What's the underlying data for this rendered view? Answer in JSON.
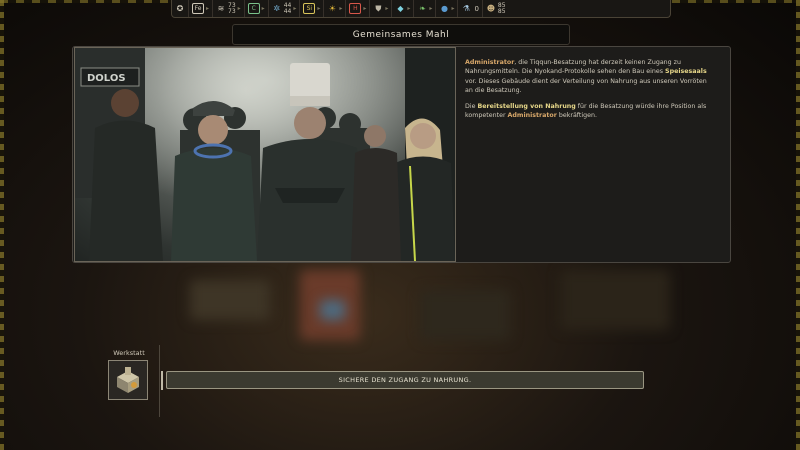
{
  "resource_bar": {
    "iron": {
      "icon": "fe-icon",
      "symbol": "Fe"
    },
    "materials": {
      "icon": "stack-icon",
      "top": "73",
      "bottom": "73"
    },
    "components": {
      "icon": "c-icon",
      "symbol": "C"
    },
    "machine_parts": {
      "icon": "gear-icon",
      "top": "44",
      "bottom": "44"
    },
    "silicon": {
      "icon": "si-icon",
      "symbol": "Si"
    },
    "energy": {
      "icon": "sun-icon",
      "symbol": "☀"
    },
    "health": {
      "icon": "h-icon",
      "symbol": "H"
    },
    "chemistry": {
      "icon": "flask-icon",
      "value": "0"
    },
    "population": {
      "icon": "population-icon",
      "top": "85",
      "bottom": "85"
    }
  },
  "event": {
    "title": "Gemeinsames Mahl",
    "paragraph1": {
      "hl1": "Administrator",
      "t1": ", die Tiqqun-Besatzung hat derzeit keinen Zugang zu Nahrungsmitteln. Die Nyokand-Protokolle sehen den Bau eines ",
      "hl2": "Speisesaals",
      "t2": " vor. Dieses Gebäude dient der Verteilung von Nahrung aus unseren Vorröten an die Besatzung."
    },
    "paragraph2": {
      "t1": " Die ",
      "hl1": "Bereitstellung von Nahrung",
      "t2": " für die Besatzung würde ihre Position als kompetenter ",
      "hl2": "Administrator",
      "t3": " bekräftigen."
    },
    "art_sign": "DOLOS"
  },
  "workshop": {
    "label": "Werkstatt",
    "icon": "workshop-icon"
  },
  "choice": {
    "label": "SICHERE DEN ZUGANG ZU NAHRUNG."
  }
}
